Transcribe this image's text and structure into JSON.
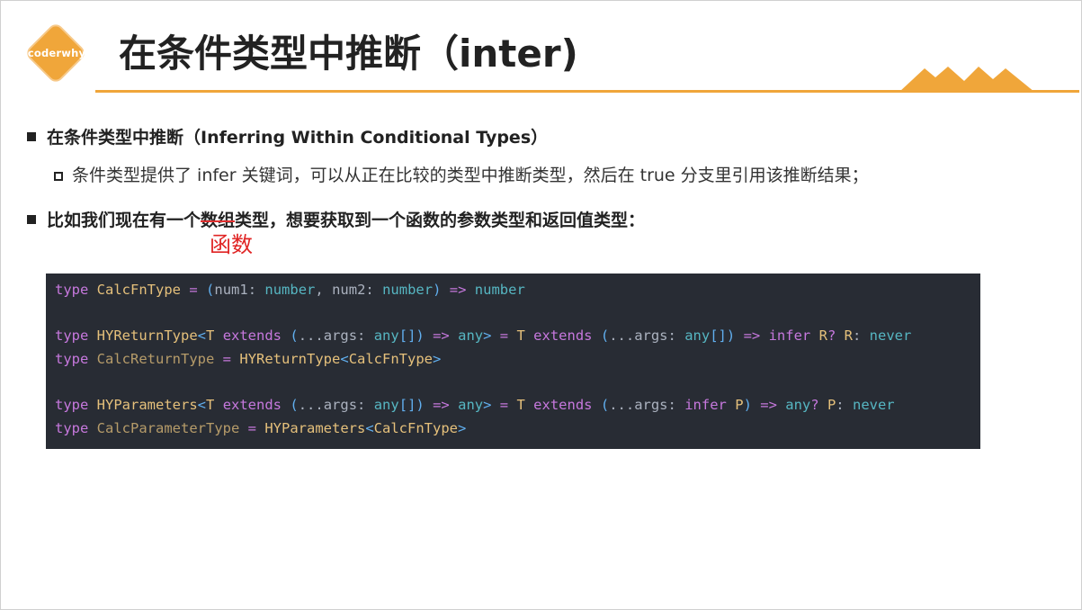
{
  "logo": {
    "text": "coderwhy"
  },
  "title": "在条件类型中推断（inter)",
  "bullet1": "在条件类型中推断（Inferring Within Conditional Types）",
  "sub1": "条件类型提供了 infer 关键词，可以从正在比较的类型中推断类型，然后在 true 分支里引用该推断结果；",
  "bullet2": {
    "before": "比如我们现在有一个",
    "struck": "数组",
    "after": "类型，想要获取到一个函数的参数类型和返回值类型：",
    "annotation": "函数"
  },
  "code": {
    "lines": [
      "type CalcFnType = (num1: number, num2: number) => number",
      "",
      "type HYReturnType<T extends (...args: any[]) => any> = T extends (...args: any[]) => infer R? R: never",
      "type CalcReturnType = HYReturnType<CalcFnType>",
      "",
      "type HYParameters<T extends (...args: any[]) => any> = T extends (...args: infer P) => any? P: never",
      "type CalcParameterType = HYParameters<CalcFnType>"
    ]
  },
  "colors": {
    "accent": "#f0a63a",
    "code_bg": "#282c34",
    "annotation": "#e02424"
  }
}
